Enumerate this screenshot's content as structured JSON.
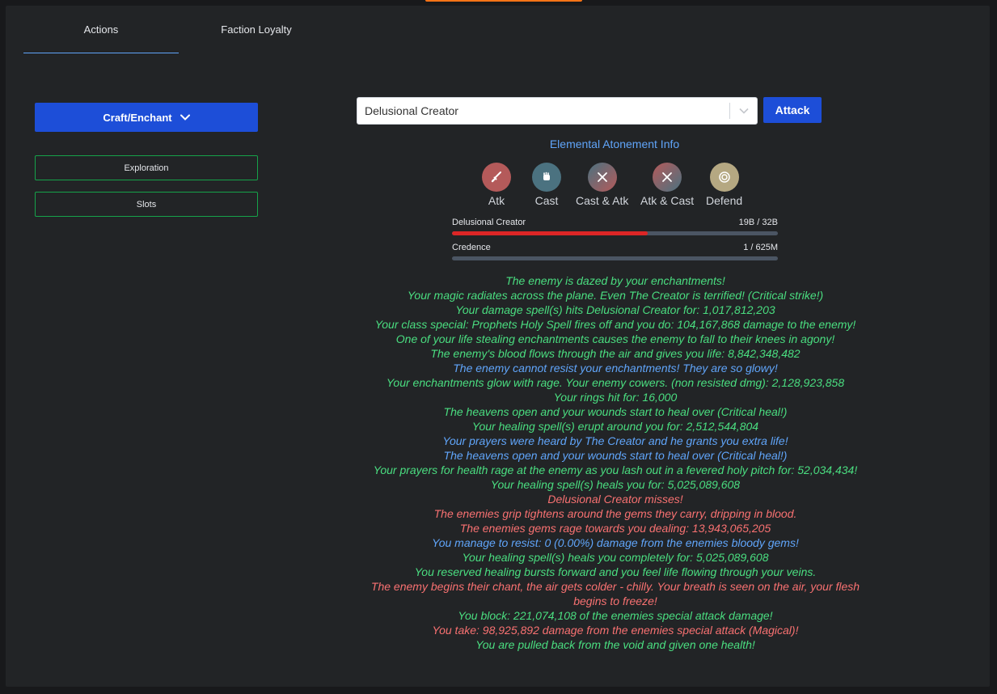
{
  "tabs": [
    {
      "label": "Actions",
      "active": true
    },
    {
      "label": "Faction Loyalty",
      "active": false
    }
  ],
  "sidebar": {
    "craft_label": "Craft/Enchant",
    "exploration_label": "Exploration",
    "slots_label": "Slots"
  },
  "monster_select": {
    "value": "Delusional Creator"
  },
  "attack_label": "Attack",
  "atonement_link": "Elemental Atonement Info",
  "attack_types": [
    {
      "label": "Atk",
      "icon": "sword-icon",
      "color": "#b45a5a"
    },
    {
      "label": "Cast",
      "icon": "fist-spell-icon",
      "color": "#4b7280"
    },
    {
      "label": "Cast & Atk",
      "icon": "crossed-swords-icon",
      "color": "#6b6e80"
    },
    {
      "label": "Atk & Cast",
      "icon": "crossed-swords-icon",
      "color": "#7a6470"
    },
    {
      "label": "Defend",
      "icon": "shield-icon",
      "color": "#b5a882"
    }
  ],
  "enemy_health": {
    "name": "Delusional Creator",
    "text": "19B / 32B",
    "fraction": 0.6
  },
  "player_health": {
    "name": "Credence",
    "text": "1 / 625M",
    "fraction": 0.0
  },
  "battle_log": [
    {
      "text": "The enemy is dazed by your enchantments!",
      "color": "green"
    },
    {
      "text": "Your magic radiates across the plane. Even The Creator is terrified! (Critical strike!)",
      "color": "green"
    },
    {
      "text": "Your damage spell(s) hits Delusional Creator for: 1,017,812,203",
      "color": "green"
    },
    {
      "text": "Your class special: Prophets Holy Spell fires off and you do: 104,167,868 damage to the enemy!",
      "color": "green"
    },
    {
      "text": "One of your life stealing enchantments causes the enemy to fall to their knees in agony!",
      "color": "green"
    },
    {
      "text": "The enemy's blood flows through the air and gives you life: 8,842,348,482",
      "color": "green"
    },
    {
      "text": "The enemy cannot resist your enchantments! They are so glowy!",
      "color": "blue"
    },
    {
      "text": "Your enchantments glow with rage. Your enemy cowers. (non resisted dmg): 2,128,923,858",
      "color": "green"
    },
    {
      "text": "Your rings hit for: 16,000",
      "color": "green"
    },
    {
      "text": "The heavens open and your wounds start to heal over (Critical heal!)",
      "color": "green"
    },
    {
      "text": "Your healing spell(s) erupt around you for: 2,512,544,804",
      "color": "green"
    },
    {
      "text": "Your prayers were heard by The Creator and he grants you extra life!",
      "color": "blue"
    },
    {
      "text": "The heavens open and your wounds start to heal over (Critical heal!)",
      "color": "blue"
    },
    {
      "text": "Your prayers for health rage at the enemy as you lash out in a fevered holy pitch for: 52,034,434!",
      "color": "green"
    },
    {
      "text": "Your healing spell(s) heals you for: 5,025,089,608",
      "color": "green"
    },
    {
      "text": "Delusional Creator misses!",
      "color": "red"
    },
    {
      "text": "The enemies grip tightens around the gems they carry, dripping in blood.",
      "color": "red"
    },
    {
      "text": "The enemies gems rage towards you dealing: 13,943,065,205",
      "color": "red"
    },
    {
      "text": "You manage to resist: 0 (0.00%) damage from the enemies bloody gems!",
      "color": "blue"
    },
    {
      "text": "Your healing spell(s) heals you completely for: 5,025,089,608",
      "color": "green"
    },
    {
      "text": "You reserved healing bursts forward and you feel life flowing through your veins.",
      "color": "green"
    },
    {
      "text": "The enemy begins their chant, the air gets colder - chilly. Your breath is seen on the air, your flesh begins to freeze!",
      "color": "red"
    },
    {
      "text": "You block: 221,074,108 of the enemies special attack damage!",
      "color": "green"
    },
    {
      "text": "You take: 98,925,892 damage from the enemies special attack (Magical)!",
      "color": "red"
    },
    {
      "text": "You are pulled back from the void and given one health!",
      "color": "green"
    }
  ]
}
